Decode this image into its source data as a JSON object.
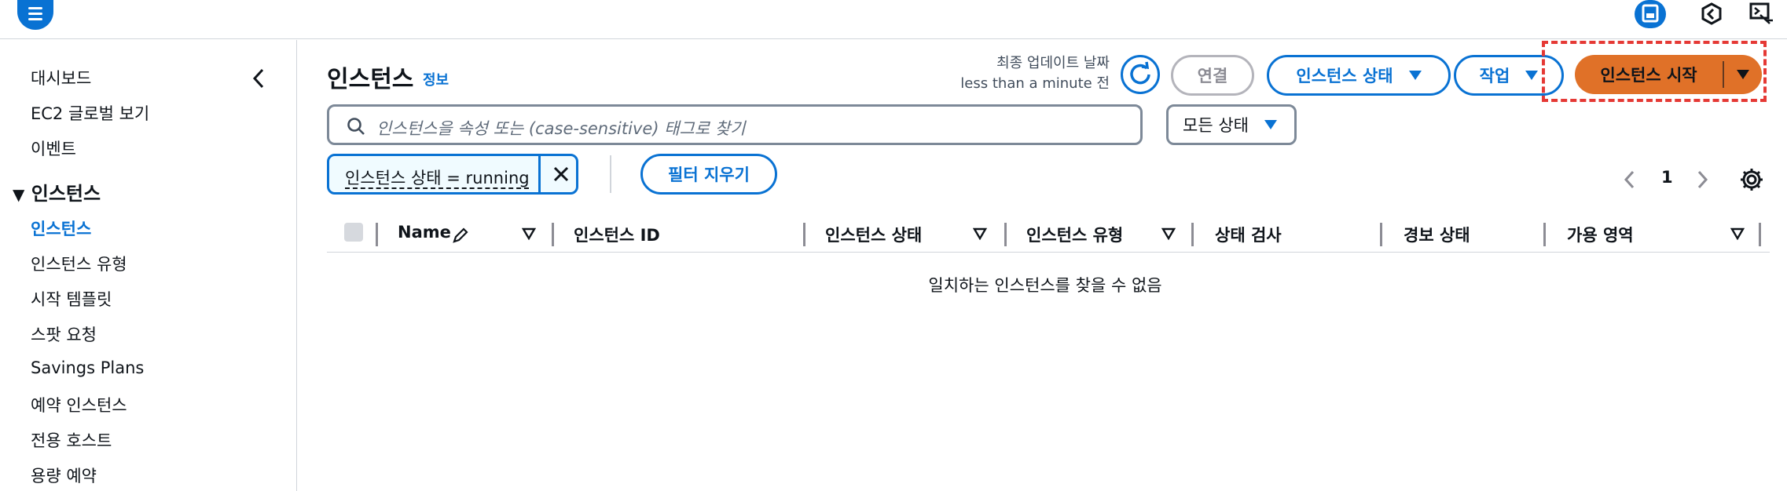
{
  "colors": {
    "accent": "#0972d3",
    "primary_button": "#e07128",
    "highlight": "#e53935"
  },
  "topbar": {
    "menu_icon": "hamburger-menu-icon",
    "right_icons": [
      "panel-icon",
      "hex-settings-icon",
      "cloudshell-icon"
    ]
  },
  "sidebar": {
    "items_top": [
      "대시보드",
      "EC2 글로벌 보기",
      "이벤트"
    ],
    "section_title": "인스턴스",
    "section_items": [
      "인스턴스",
      "인스턴스 유형",
      "시작 템플릿",
      "스팟 요청",
      "Savings Plans",
      "예약 인스턴스",
      "전용 호스트",
      "용량 예약"
    ],
    "active_item": "인스턴스"
  },
  "header": {
    "title": "인스턴스",
    "info_link": "정보",
    "last_updated_label": "최종 업데이트 날짜",
    "last_updated_value": "less than a minute 전"
  },
  "actions": {
    "connect": "연결",
    "instance_state": "인스턴스 상태",
    "actions": "작업",
    "launch": "인스턴스 시작"
  },
  "search": {
    "placeholder": "인스턴스을 속성 또는 (case-sensitive) 태그로 찾기"
  },
  "state_filter": {
    "selected": "모든 상태"
  },
  "filter": {
    "token": "인스턴스 상태 = running",
    "clear_label": "필터 지우기"
  },
  "pagination": {
    "current_page": "1"
  },
  "table": {
    "columns": [
      "Name",
      "인스턴스 ID",
      "인스턴스 상태",
      "인스턴스 유형",
      "상태 검사",
      "경보 상태",
      "가용 영역"
    ],
    "empty_message": "일치하는 인스턴스를 찾을 수 없음"
  }
}
